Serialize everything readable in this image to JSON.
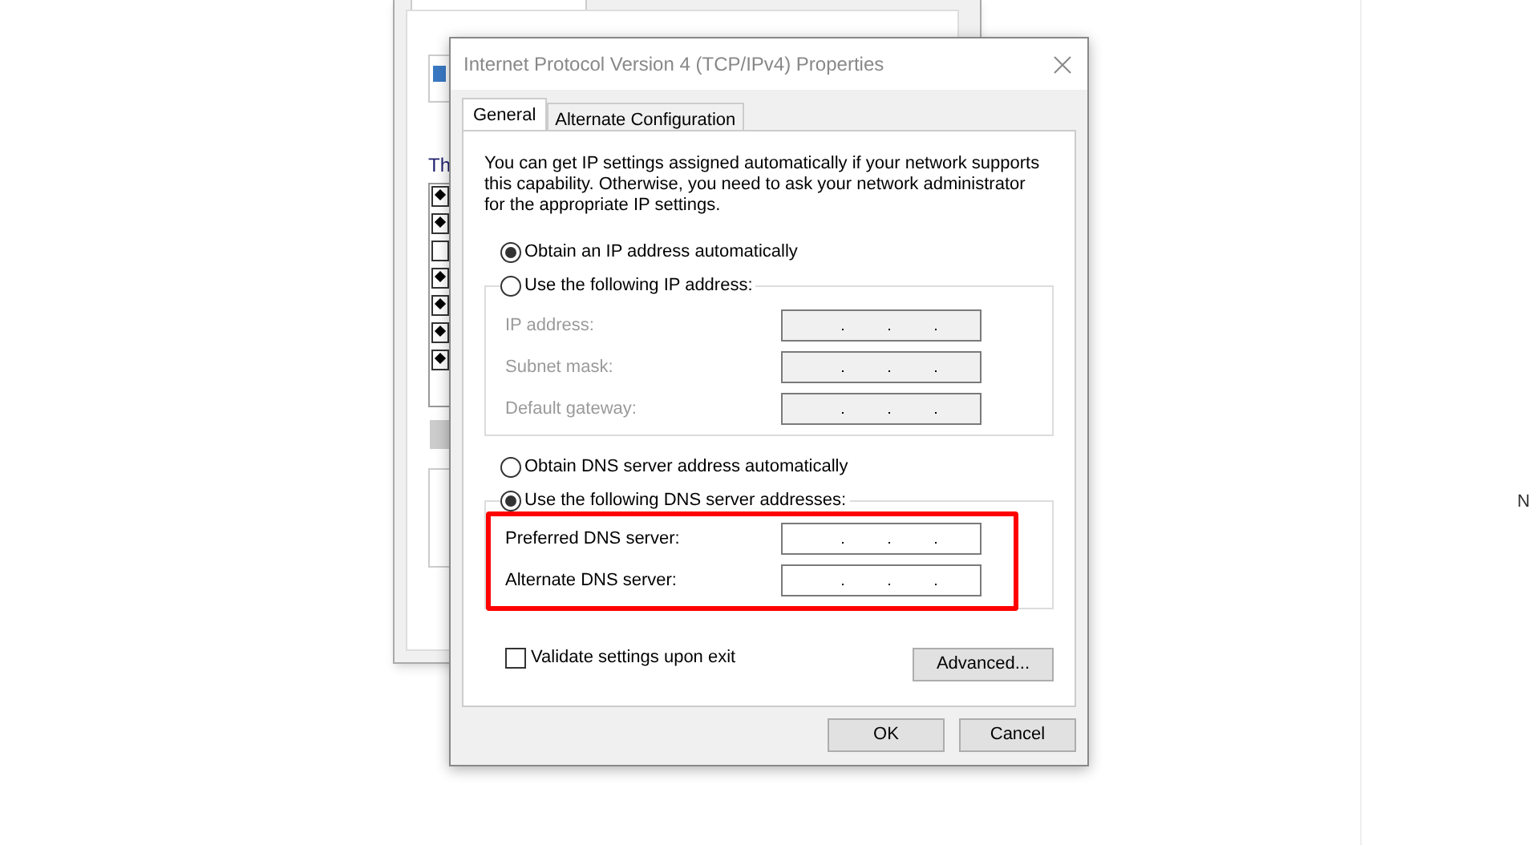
{
  "background_window": {
    "list_label": "Th",
    "items": [
      {
        "checked": true
      },
      {
        "checked": true
      },
      {
        "checked": false
      },
      {
        "checked": true
      },
      {
        "checked": true
      },
      {
        "checked": true
      },
      {
        "checked": true
      }
    ]
  },
  "right_edge_text": "N",
  "dialog": {
    "title": "Internet Protocol Version 4 (TCP/IPv4) Properties",
    "tabs": [
      {
        "label": "General",
        "selected": true
      },
      {
        "label": "Alternate Configuration",
        "selected": false
      }
    ],
    "description": "You can get IP settings assigned automatically if your network supports this capability. Otherwise, you need to ask your network administrator for the appropriate IP settings.",
    "ip_options": [
      {
        "label": "Obtain an IP address automatically",
        "selected": true
      },
      {
        "label": "Use the following IP address:",
        "selected": false
      }
    ],
    "ip_fields": [
      {
        "label": "IP address:",
        "disabled": true
      },
      {
        "label": "Subnet mask:",
        "disabled": true
      },
      {
        "label": "Default gateway:",
        "disabled": true
      }
    ],
    "dns_options": [
      {
        "label": "Obtain DNS server address automatically",
        "selected": false
      },
      {
        "label": "Use the following DNS server addresses:",
        "selected": true
      }
    ],
    "dns_fields": [
      {
        "label": "Preferred DNS server:",
        "disabled": false
      },
      {
        "label": "Alternate DNS server:",
        "disabled": false
      }
    ],
    "validate": {
      "label": "Validate settings upon exit",
      "checked": false
    },
    "advanced_button": "Advanced...",
    "buttons": [
      "OK",
      "Cancel"
    ]
  }
}
